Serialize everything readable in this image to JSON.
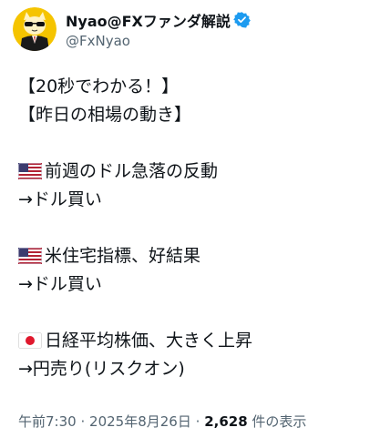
{
  "author": {
    "display_name": "Nyao@FXファンダ解説",
    "handle": "@FxNyao",
    "avatar": "cat-in-sunglasses-avatar",
    "verified_icon": "verified-badge-icon"
  },
  "tweet": {
    "lines": [
      "【20秒でわかる！】",
      "【昨日の相場の動き】",
      "前週のドル急落の反動",
      "→ドル買い",
      "米住宅指標、好結果",
      "→ドル買い",
      "日経平均株価、大きく上昇",
      "→円売り(リスクオン)"
    ],
    "flags": [
      "us-flag-icon",
      "us-flag-icon",
      "japan-flag-icon"
    ]
  },
  "meta": {
    "time": "午前7:30",
    "separator": "·",
    "date": "2025年8月26日",
    "views_count": "2,628",
    "views_label": "件の表示"
  },
  "colors": {
    "text": "#0f1419",
    "secondary": "#536471",
    "verified": "#1d9bf0",
    "avatar_bg": "#f5c400"
  }
}
